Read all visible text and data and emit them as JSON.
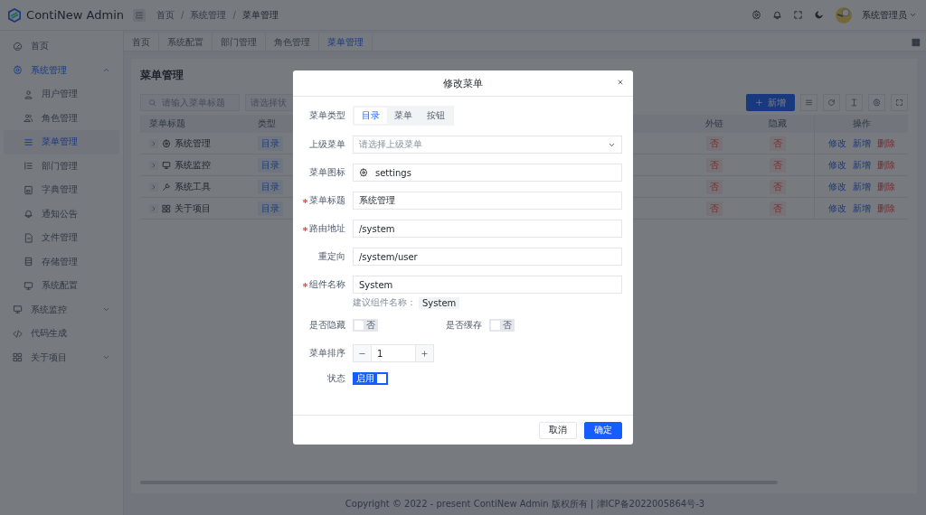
{
  "app": {
    "logo_text": "ContiNew Admin"
  },
  "header": {
    "breadcrumb": [
      "首页",
      "系统管理",
      "菜单管理"
    ],
    "breadcrumb_separators": [
      "/",
      "/"
    ],
    "user": "系统管理员"
  },
  "sidebar": {
    "items": [
      {
        "label": "首页",
        "selected": false
      },
      {
        "label": "系统管理",
        "selected": true,
        "expanded": true,
        "children": [
          {
            "label": "用户管理",
            "selected": false
          },
          {
            "label": "角色管理",
            "selected": false
          },
          {
            "label": "菜单管理",
            "selected": true
          },
          {
            "label": "部门管理",
            "selected": false
          },
          {
            "label": "字典管理",
            "selected": false
          },
          {
            "label": "通知公告",
            "selected": false
          },
          {
            "label": "文件管理",
            "selected": false
          },
          {
            "label": "存储管理",
            "selected": false
          },
          {
            "label": "系统配置",
            "selected": false
          }
        ]
      },
      {
        "label": "系统监控",
        "selected": false,
        "expanded": false
      },
      {
        "label": "代码生成",
        "selected": false
      },
      {
        "label": "关于项目",
        "selected": false,
        "expanded": false
      }
    ]
  },
  "tabs": [
    {
      "label": "首页",
      "selected": false
    },
    {
      "label": "系统配置",
      "selected": false
    },
    {
      "label": "部门管理",
      "selected": false
    },
    {
      "label": "角色管理",
      "selected": false
    },
    {
      "label": "菜单管理",
      "selected": true
    }
  ],
  "page": {
    "title": "菜单管理",
    "search": {
      "placeholder": "请输入菜单标题"
    },
    "status_select": {
      "placeholder": "请选择状"
    },
    "add_button": "新增"
  },
  "table": {
    "columns": [
      "菜单标题",
      "类型",
      "外链",
      "隐藏",
      "操作"
    ],
    "rows": [
      {
        "title": "系统管理",
        "type": "目录",
        "external": "否",
        "hidden": "否",
        "actions": [
          "修改",
          "新增",
          "删除"
        ]
      },
      {
        "title": "系统监控",
        "type": "目录",
        "external": "否",
        "hidden": "否",
        "actions": [
          "修改",
          "新增",
          "删除"
        ]
      },
      {
        "title": "系统工具",
        "type": "目录",
        "external": "否",
        "hidden": "否",
        "actions": [
          "修改",
          "新增",
          "删除"
        ]
      },
      {
        "title": "关于项目",
        "type": "目录",
        "external": "否",
        "hidden": "否",
        "actions": [
          "修改",
          "新增",
          "删除"
        ]
      }
    ]
  },
  "modal": {
    "title": "修改菜单",
    "fields": [
      {
        "kind": "segmented",
        "label": "菜单类型",
        "options": [
          {
            "label": "目录",
            "selected": true
          },
          {
            "label": "菜单",
            "selected": false
          },
          {
            "label": "按钮",
            "selected": false
          }
        ]
      },
      {
        "kind": "select",
        "label": "上级菜单",
        "placeholder": "请选择上级菜单"
      },
      {
        "kind": "icon",
        "label": "菜单图标",
        "value": "settings"
      },
      {
        "kind": "input",
        "label": "菜单标题",
        "required": true,
        "value": "系统管理"
      },
      {
        "kind": "input",
        "label": "路由地址",
        "required": true,
        "value": "/system"
      },
      {
        "kind": "input",
        "label": "重定向",
        "required": false,
        "value": "/system/user"
      },
      {
        "kind": "input",
        "label": "组件名称",
        "required": true,
        "value": "System",
        "hint": "建议组件名称：",
        "suggestion": "System"
      },
      {
        "kind": "switches",
        "items": [
          {
            "label": "是否隐藏",
            "on": false,
            "text": "否"
          },
          {
            "label": "是否缓存",
            "on": false,
            "text": "否"
          }
        ]
      },
      {
        "kind": "number",
        "label": "菜单排序",
        "value": "1"
      },
      {
        "kind": "switch",
        "label": "状态",
        "on": true,
        "text": "启用"
      }
    ],
    "buttons": [
      {
        "label": "取消",
        "primary": false
      },
      {
        "label": "确定",
        "primary": true
      }
    ]
  },
  "footer": {
    "copyright": "Copyright © 2022 - present ContiNew Admin 版权所有 | 津ICP备2022005864号-3"
  }
}
